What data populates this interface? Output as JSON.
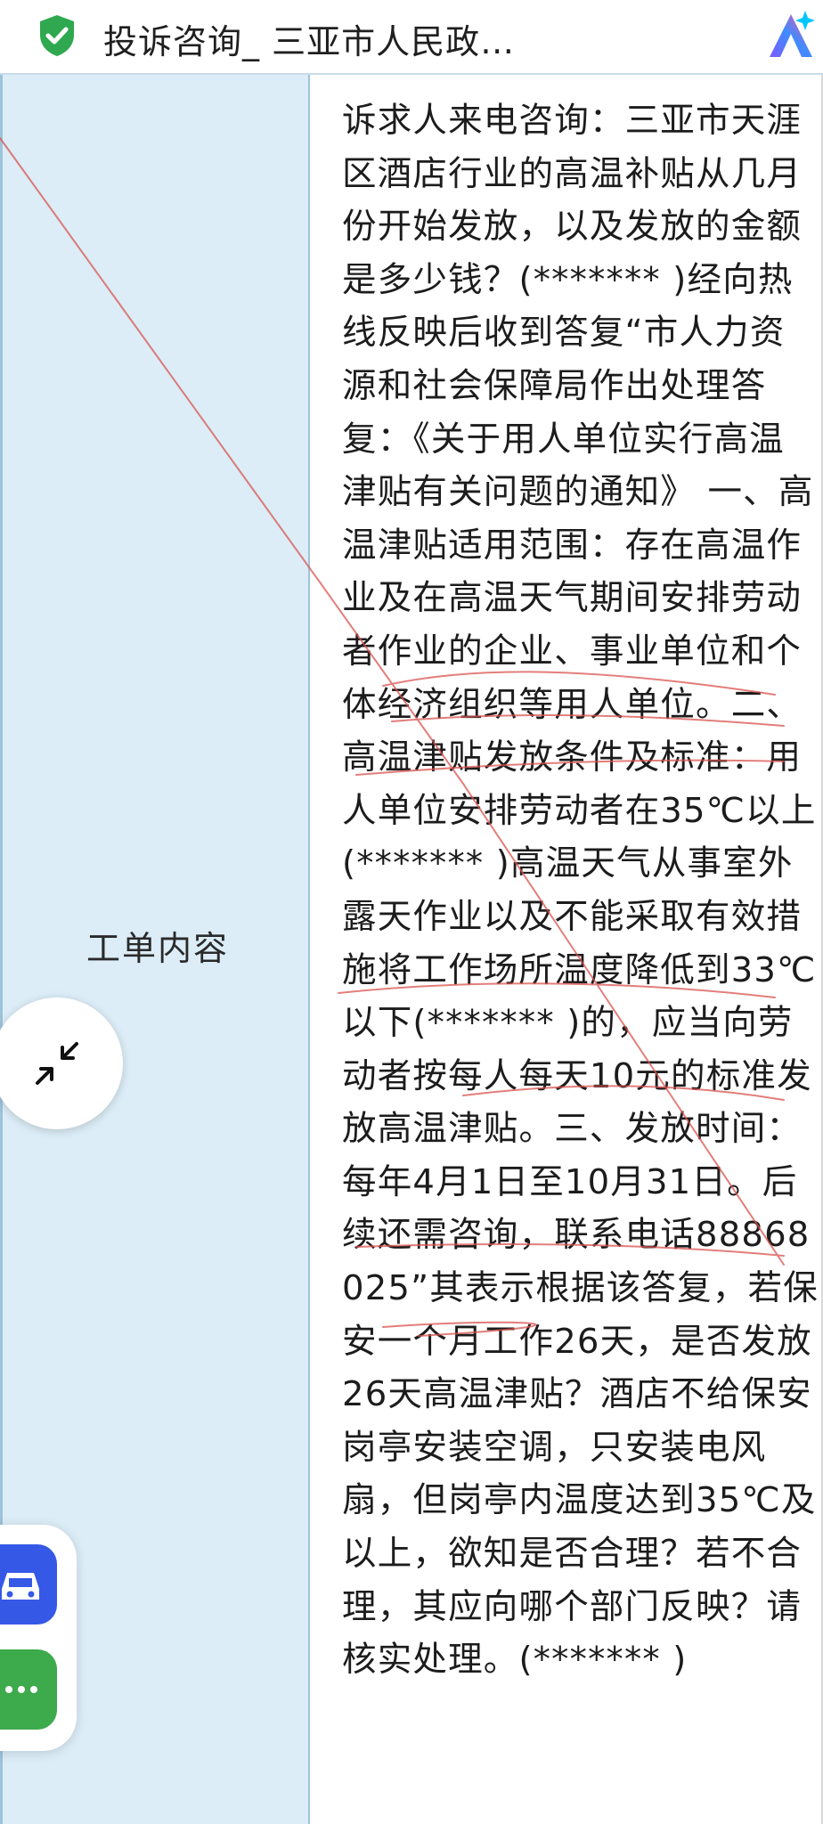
{
  "header": {
    "title": "投诉咨询_ 三亚市人民政…",
    "shield_icon": "shield-check-icon",
    "ai_icon": "ai-assistant-icon",
    "shield_color": "#2fa84f"
  },
  "table": {
    "label": "工单内容",
    "content": "诉求人来电咨询：三亚市天涯区酒店行业的高温补贴从几月份开始发放，以及发放的金额是多少钱？(******* )经向热线反映后收到答复“市人力资源和社会保障局作出处理答复：《关于用人单位实行高温津贴有关问题的通知》 一、高温津贴适用范围：存在高温作业及在高温天气期间安排劳动者作业的企业、事业单位和个体经济组织等用人单位。二、高温津贴发放条件及标准：用人单位安排劳动者在35℃以上(******* )高温天气从事室外露天作业以及不能采取有效措施将工作场所温度降低到33℃以下(******* )的，应当向劳动者按每人每天10元的标准发放高温津贴。三、发放时间：每年4月1日至10月31日。后续还需咨询，联系电话88868025”其表示根据该答复，若保安一个月工作26天，是否发放26天高温津贴？酒店不给保安岗亭安装空调，只安装电风扇，但岗亭内温度达到35℃及以上，欲知是否合理？若不合理，其应向哪个部门反映？请核实处理。(******* )"
  },
  "floating": {
    "collapse_icon": "collapse-arrows-icon",
    "car_icon": "car-icon",
    "more_icon": "more-dots-icon",
    "car_color": "#3559e6",
    "more_color": "#3daa4c"
  }
}
